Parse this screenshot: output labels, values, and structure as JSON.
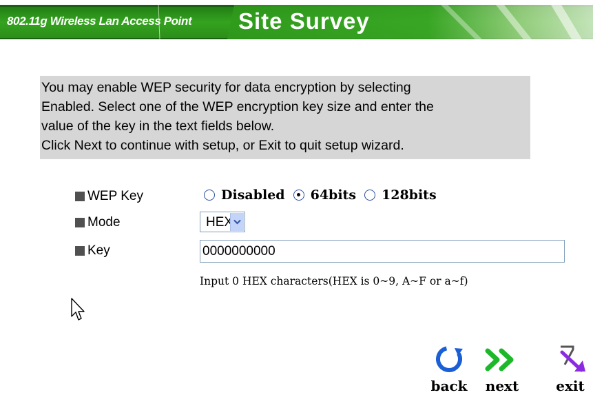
{
  "header": {
    "subtitle": "802.11g Wireless Lan Access Point",
    "title": "Site Survey"
  },
  "intro": {
    "line1": "You may enable WEP security for data encryption by selecting",
    "line2": "Enabled. Select one of the WEP encryption key size and enter the",
    "line3": "value of the key in the text fields below.",
    "line4": "Click Next to continue with setup, or Exit to quit setup wizard."
  },
  "form": {
    "wep_label": "WEP Key",
    "wep_options": [
      "Disabled",
      "64bits",
      "128bits"
    ],
    "wep_selected": "64bits",
    "mode_label": "Mode",
    "mode_value": "HEX",
    "key_label": "Key",
    "key_value": "0000000000",
    "hint": "Input 0 HEX characters(HEX is 0~9, A~F or a~f)"
  },
  "nav": {
    "back": "back",
    "next": "next",
    "exit": "exit"
  },
  "colors": {
    "header_green": "#2e8b1e",
    "intro_bg": "#d6d6d6",
    "back_blue": "#1a5fd6",
    "next_green": "#1db82a",
    "exit_purple": "#8a2be2"
  }
}
